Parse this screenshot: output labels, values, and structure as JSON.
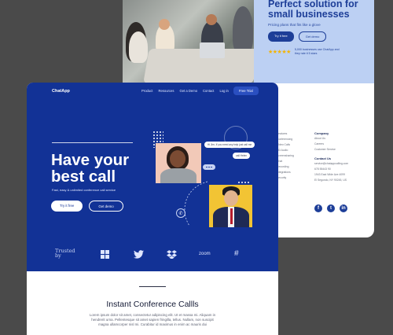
{
  "back_page": {
    "hero_title": "Perfect solution for small businesses",
    "hero_subtitle": "Pricing plans that fits like a glove",
    "try_btn": "Try it free",
    "demo_btn": "Get demo",
    "stars": "★★★★★",
    "rating_text": "5,000 businesses use ChatApp and they rate it 5 stars",
    "footer": {
      "company_head": "Company",
      "company_links": [
        "About Us",
        "Careers",
        "Customer Service"
      ],
      "contact_head": "Contact Us",
      "contact_lines": [
        "service@chatappcalling.com",
        "678 55443 90",
        "1943 East Wide Ave 4099",
        "El Segundo, NY 90245, US"
      ],
      "left_col": [
        "Features",
        "Conferencing",
        "Video Calls",
        "HD Audio",
        "Screensharing",
        "Chat",
        "Recording",
        "Integrations",
        "Security"
      ]
    },
    "social_icons": [
      "facebook-icon",
      "twitter-icon",
      "linkedin-icon"
    ]
  },
  "front_page": {
    "logo": "ChatApp",
    "nav": [
      "Product",
      "Resources",
      "Get a Demo",
      "Contact",
      "Log in"
    ],
    "free_trial": "Free Trial",
    "hero_title_line1": "Have your",
    "hero_title_line2": "best call",
    "hero_subtitle": "Fast, easy & unlimited conference call service",
    "try_btn": "Try it free",
    "demo_btn": "Get demo",
    "bubble1": "Hi Jim, If you need any help just call me",
    "bubble2": "call Helen",
    "trusted_by": "Trusted by",
    "brands": [
      "windows-icon",
      "twitter-icon",
      "dropbox-icon",
      "zoom",
      "slack-icon"
    ],
    "zoom_label": "zoom",
    "section_title": "Instant Conference Callls",
    "section_body": "Lorem ipsum dolor sit amet, consectetur adipiscing elit. Ut et massa mi. Aliquam in hendrerit urna. Pellentesque sit amet sapien fringilla, tellus. Nullam, non suscipit magna ullamcorper nisl mi. Curabitur id maximus in enim ac mauris dui"
  },
  "colors": {
    "brand_blue": "#123296",
    "light_blue": "#bcd0f3",
    "star": "#f4b400"
  }
}
